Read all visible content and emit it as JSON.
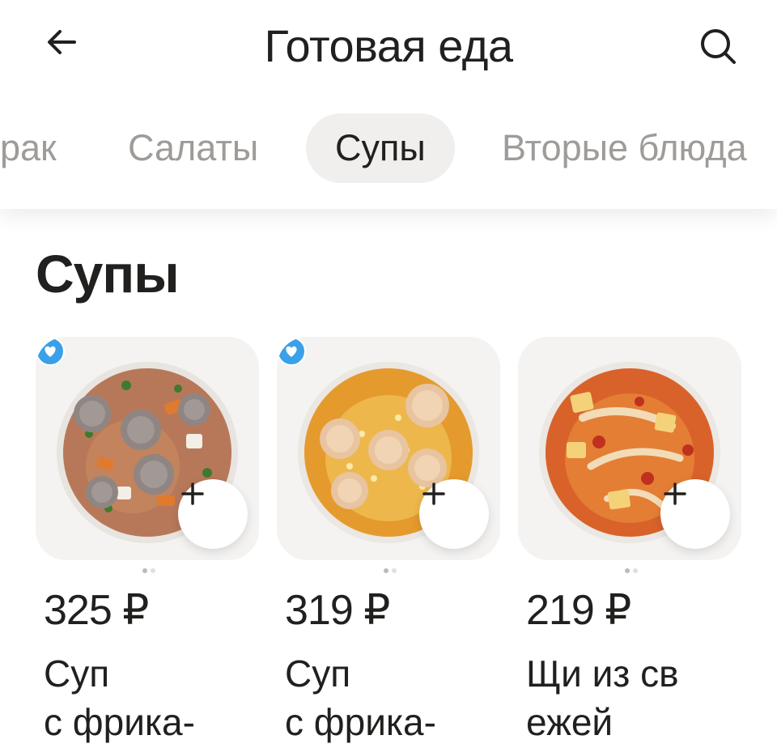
{
  "header": {
    "title": "Готовая еда",
    "back_icon": "arrow-left-icon",
    "search_icon": "search-icon"
  },
  "tabs": [
    {
      "label": "рак",
      "active": false
    },
    {
      "label": "Салаты",
      "active": false
    },
    {
      "label": "Супы",
      "active": true
    },
    {
      "label": "Вторые блюда",
      "active": false
    }
  ],
  "section": {
    "title": "Супы"
  },
  "products": [
    {
      "price": "325 ₽",
      "name": "Суп\nс фрика-",
      "favorite_icon": "heart-badge-icon",
      "add_icon": "plus-icon"
    },
    {
      "price": "319 ₽",
      "name": "Суп\nс фрика-",
      "favorite_icon": "heart-badge-icon",
      "add_icon": "plus-icon"
    },
    {
      "price": "219 ₽",
      "name": "Щи из св\nежей",
      "add_icon": "plus-icon"
    }
  ],
  "colors": {
    "text": "#21201f",
    "muted_tab": "#9e9b98",
    "active_tab_bg": "#f0efed",
    "card_bg": "#f4f3f2",
    "badge_blue": "#3aa0e8"
  }
}
